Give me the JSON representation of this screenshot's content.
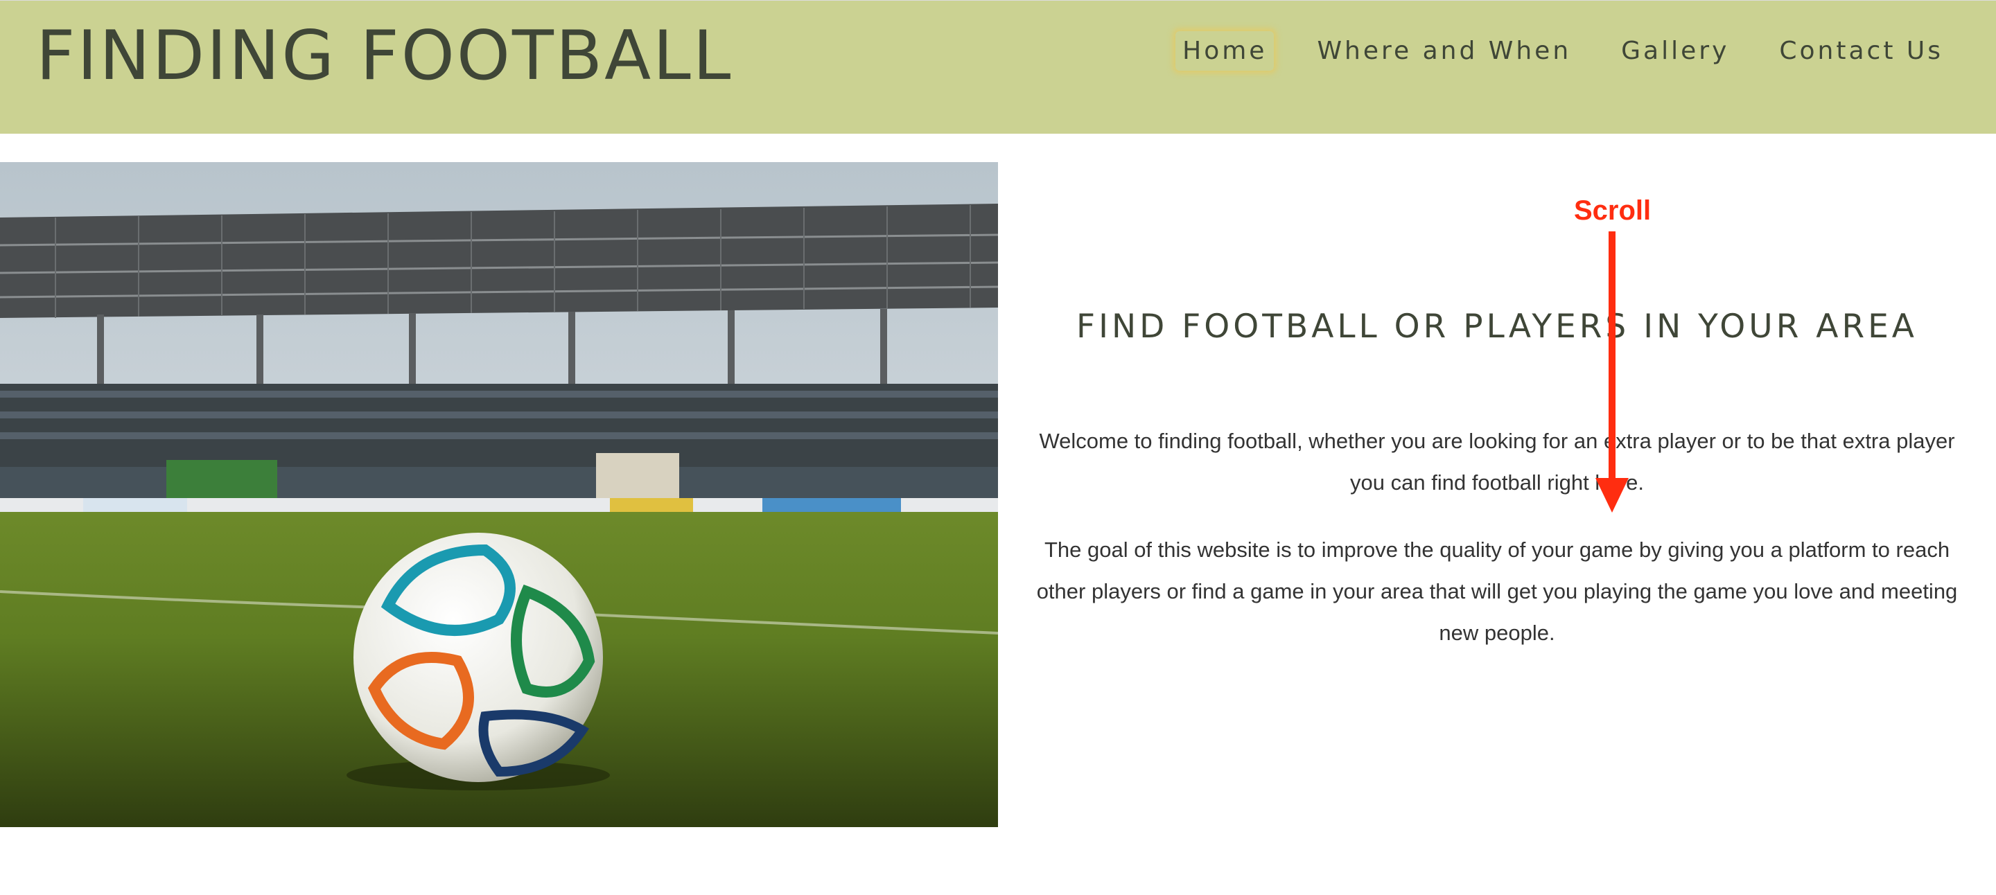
{
  "header": {
    "logo": "FINDING FOOTBALL",
    "nav": [
      {
        "label": "Home",
        "active": true
      },
      {
        "label": "Where and When",
        "active": false
      },
      {
        "label": "Gallery",
        "active": false
      },
      {
        "label": "Contact Us",
        "active": false
      }
    ]
  },
  "main": {
    "heading": "FIND FOOTBALL OR PLAYERS IN YOUR AREA",
    "paragraphs": [
      "Welcome to finding football, whether you are looking for an extra player or to be that extra player you can find football right here.",
      "The goal of this website is to improve the quality of your game by giving you a platform to reach other players or find a game in your area that will get you playing the game you love and meeting new people."
    ]
  },
  "annotation": {
    "label": "Scroll",
    "color": "#ff2d10"
  },
  "colors": {
    "header_bg": "#cbd292",
    "text": "#3f4637",
    "active_glow": "#eec650"
  }
}
